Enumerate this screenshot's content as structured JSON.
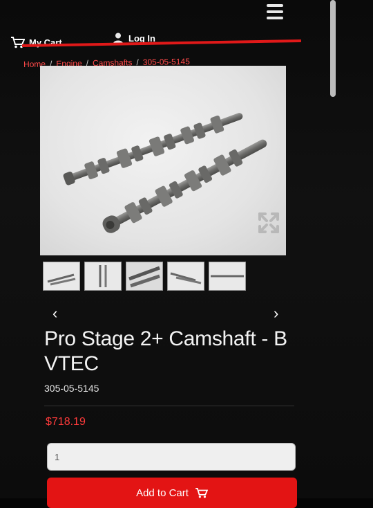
{
  "header": {
    "cart_label": "My Cart",
    "login_label": "Log In",
    "menu_icon": "hamburger-menu-icon",
    "accent_color": "#e01919"
  },
  "breadcrumb": {
    "items": [
      "Home",
      "Engine",
      "Camshafts",
      "305-05-5145"
    ]
  },
  "gallery": {
    "thumbnail_count": 5,
    "expand_icon": "expand-icon"
  },
  "product": {
    "title": "Pro Stage 2+ Camshaft - B VTEC",
    "sku": "305-05-5145",
    "price": "$718.19",
    "price_color": "#ff3b3b"
  },
  "purchase": {
    "quantity_value": "1",
    "add_to_cart_label": "Add to Cart",
    "button_color": "#e31414"
  }
}
